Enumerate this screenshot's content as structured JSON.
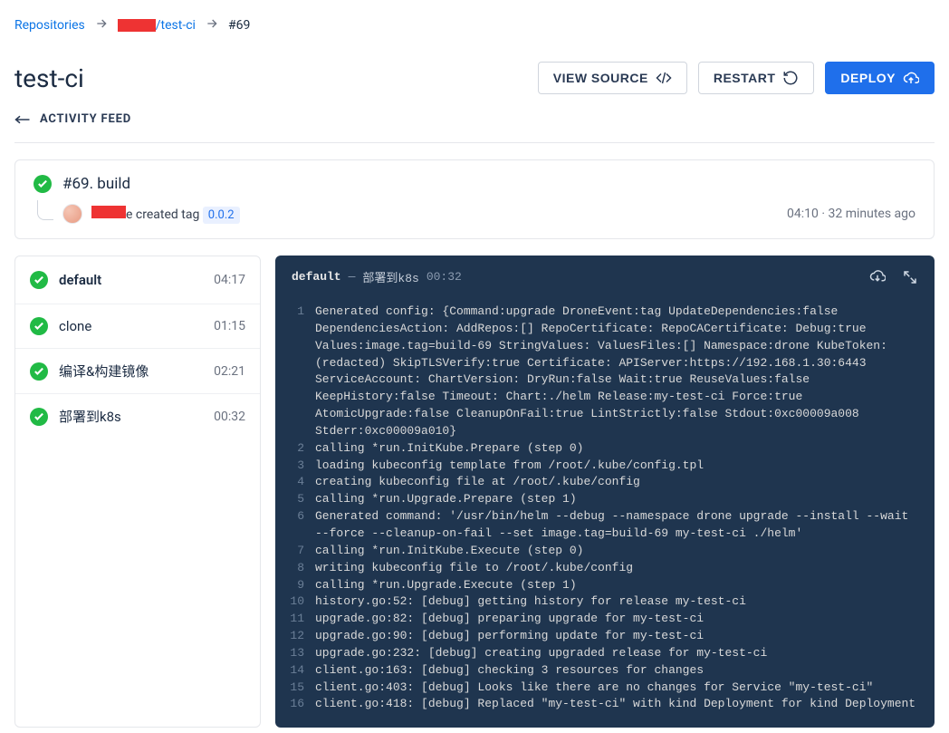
{
  "breadcrumb": {
    "root": "Repositories",
    "repo_suffix": "/test-ci",
    "build": "#69"
  },
  "header": {
    "title": "test-ci",
    "view_source": "VIEW SOURCE",
    "restart": "RESTART",
    "deploy": "DEPLOY"
  },
  "activity_feed": "ACTIVITY FEED",
  "build": {
    "title": "#69. build",
    "created_tag_text": " created tag ",
    "tag": "0.0.2",
    "e_suffix": "e",
    "time": "04:10",
    "ago": "32 minutes ago"
  },
  "steps": {
    "stage": {
      "name": "default",
      "time": "04:17"
    },
    "items": [
      {
        "name": "clone",
        "time": "01:15"
      },
      {
        "name": "编译&构建镜像",
        "time": "02:21"
      },
      {
        "name": "部署到k8s",
        "time": "00:32"
      }
    ]
  },
  "log": {
    "stage": "default",
    "step": "部署到k8s",
    "time": "00:32",
    "lines": [
      "Generated config: {Command:upgrade DroneEvent:tag UpdateDependencies:false DependenciesAction: AddRepos:[] RepoCertificate: RepoCACertificate: Debug:true Values:image.tag=build-69 StringValues: ValuesFiles:[] Namespace:drone KubeToken:(redacted) SkipTLSVerify:true Certificate: APIServer:https://192.168.1.30:6443 ServiceAccount: ChartVersion: DryRun:false Wait:true ReuseValues:false KeepHistory:false Timeout: Chart:./helm Release:my-test-ci Force:true AtomicUpgrade:false CleanupOnFail:true LintStrictly:false Stdout:0xc00009a008 Stderr:0xc00009a010}",
      "calling *run.InitKube.Prepare (step 0)",
      "loading kubeconfig template from /root/.kube/config.tpl",
      "creating kubeconfig file at /root/.kube/config",
      "calling *run.Upgrade.Prepare (step 1)",
      "Generated command: '/usr/bin/helm --debug --namespace drone upgrade --install --wait --force --cleanup-on-fail --set image.tag=build-69 my-test-ci ./helm'",
      "calling *run.InitKube.Execute (step 0)",
      "writing kubeconfig file to /root/.kube/config",
      "calling *run.Upgrade.Execute (step 1)",
      "history.go:52: [debug] getting history for release my-test-ci",
      "upgrade.go:82: [debug] preparing upgrade for my-test-ci",
      "upgrade.go:90: [debug] performing update for my-test-ci",
      "upgrade.go:232: [debug] creating upgraded release for my-test-ci",
      "client.go:163: [debug] checking 3 resources for changes",
      "client.go:403: [debug] Looks like there are no changes for Service \"my-test-ci\"",
      "client.go:418: [debug] Replaced \"my-test-ci\" with kind Deployment for kind Deployment"
    ]
  }
}
